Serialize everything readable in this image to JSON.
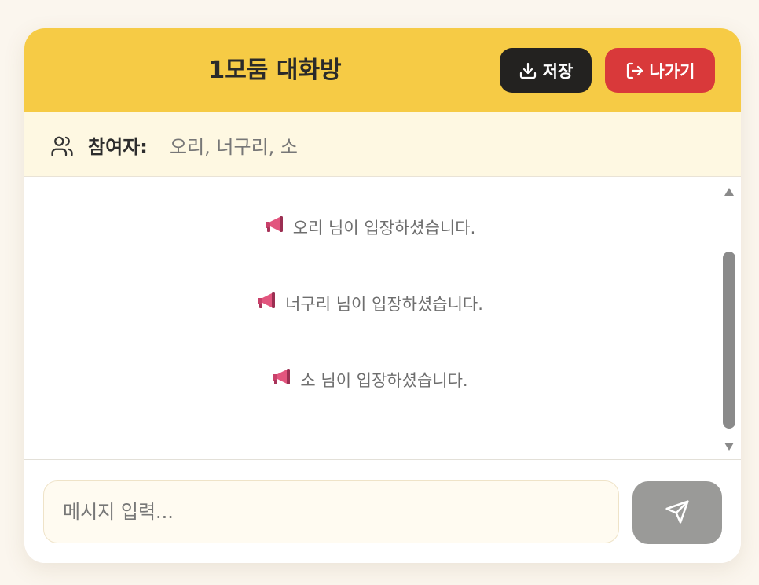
{
  "header": {
    "title": "1모둠 대화방",
    "save_label": "저장",
    "exit_label": "나가기",
    "save_icon": "download-icon",
    "exit_icon": "logout-icon",
    "background": "#f6cb45"
  },
  "participants": {
    "icon": "users-icon",
    "label": "참여자:",
    "names": "오리, 너구리, 소"
  },
  "messages": [
    {
      "icon": "megaphone-icon",
      "text": "오리 님이 입장하셨습니다."
    },
    {
      "icon": "megaphone-icon",
      "text": "너구리 님이 입장하셨습니다."
    },
    {
      "icon": "megaphone-icon",
      "text": "소 님이 입장하셨습니다."
    }
  ],
  "composer": {
    "placeholder": "메시지 입력...",
    "value": "",
    "send_icon": "send-icon"
  },
  "colors": {
    "accent": "#f6cb45",
    "save_button": "#232220",
    "exit_button": "#d9393a",
    "send_button_disabled": "#9a9a98"
  }
}
